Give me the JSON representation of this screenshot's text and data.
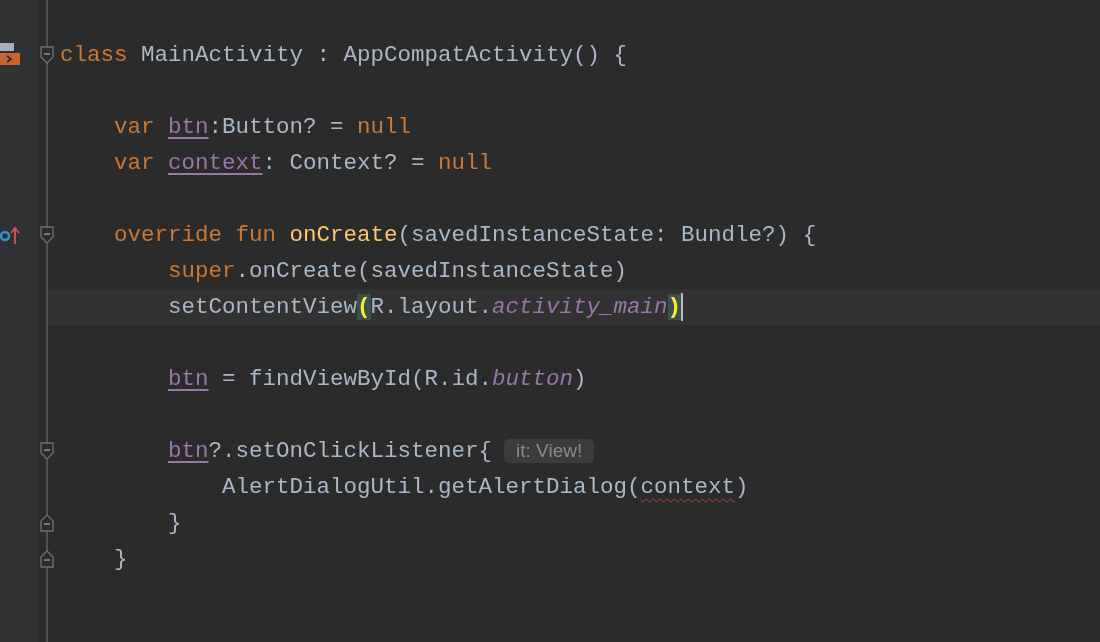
{
  "lines": [
    {
      "runnable": true,
      "foldable": true,
      "tokens": [
        {
          "kind": "kw",
          "text": "class"
        },
        {
          "kind": "plain",
          "text": " MainActivity : AppCompatActivity() {"
        }
      ],
      "children": [
        {
          "gap_before": true,
          "tokens": [
            {
              "kind": "kw",
              "text": "var "
            },
            {
              "kind": "field",
              "text": "btn"
            },
            {
              "kind": "plain",
              "text": ":Button? = "
            },
            {
              "kind": "kw",
              "text": "null"
            }
          ]
        },
        {
          "tokens": [
            {
              "kind": "kw",
              "text": "var "
            },
            {
              "kind": "field",
              "text": "context"
            },
            {
              "kind": "plain",
              "text": ": Context? = "
            },
            {
              "kind": "kw",
              "text": "null"
            }
          ]
        },
        {
          "gap_before": true,
          "overrides": true,
          "foldable": true,
          "tokens": [
            {
              "kind": "kw",
              "text": "override fun "
            },
            {
              "kind": "fn",
              "text": "onCreate"
            },
            {
              "kind": "plain",
              "text": "(savedInstanceState: Bundle?) {"
            }
          ],
          "children": [
            {
              "tokens": [
                {
                  "kind": "kw",
                  "text": "super"
                },
                {
                  "kind": "plain",
                  "text": ".onCreate(savedInstanceState)"
                }
              ]
            },
            {
              "current": true,
              "caret": true,
              "tokens": [
                {
                  "kind": "plain",
                  "text": "setContentView"
                },
                {
                  "kind": "brace",
                  "text": "("
                },
                {
                  "kind": "plain",
                  "text": "R.layout."
                },
                {
                  "kind": "italic",
                  "text": "activity_main"
                },
                {
                  "kind": "brace",
                  "text": ")"
                }
              ]
            },
            {
              "gap_before": true,
              "tokens": [
                {
                  "kind": "field",
                  "text": "btn"
                },
                {
                  "kind": "plain",
                  "text": " = findViewById(R.id."
                },
                {
                  "kind": "italic",
                  "text": "button"
                },
                {
                  "kind": "plain",
                  "text": ")"
                }
              ]
            },
            {
              "gap_before": true,
              "foldable": true,
              "tokens": [
                {
                  "kind": "field",
                  "text": "btn"
                },
                {
                  "kind": "plain",
                  "text": "?.setOnClickListener{"
                },
                {
                  "kind": "hint",
                  "text": "it: View!"
                }
              ],
              "children": [
                {
                  "tokens": [
                    {
                      "kind": "plain",
                      "text": "AlertDialogUtil.getAlertDialog("
                    },
                    {
                      "kind": "warn",
                      "text": "context"
                    },
                    {
                      "kind": "plain",
                      "text": ")"
                    }
                  ]
                }
              ]
            },
            {
              "fold_end": true,
              "tokens": [
                {
                  "kind": "plain",
                  "text": "}"
                }
              ]
            }
          ]
        },
        {
          "fold_end": true,
          "tokens": [
            {
              "kind": "plain",
              "text": "}"
            }
          ]
        }
      ]
    }
  ]
}
